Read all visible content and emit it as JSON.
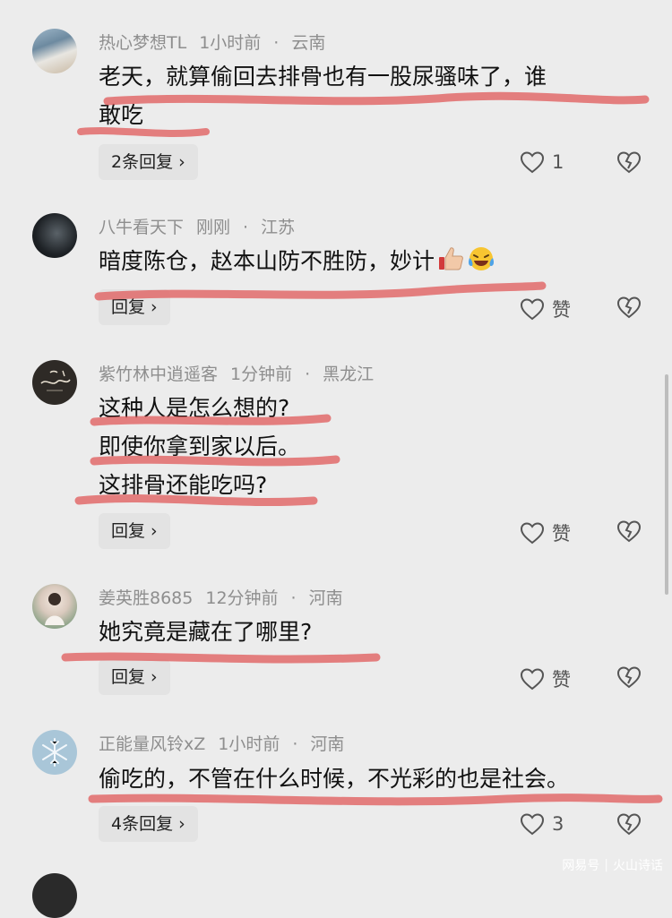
{
  "comments": [
    {
      "username": "热心梦想TL",
      "time": "1小时前",
      "location": "云南",
      "lines": [
        "老天，就算偷回去排骨也有一股尿骚味了，谁",
        "敢吃"
      ],
      "reply_label": "2条回复",
      "like_count": "1"
    },
    {
      "username": "八牛看天下",
      "time": "刚刚",
      "location": "江苏",
      "lines": [
        "暗度陈仓，赵本山防不胜防，妙计"
      ],
      "emojis": [
        "thumbs-up",
        "laughing-crying"
      ],
      "reply_label": "回复",
      "like_count": "赞"
    },
    {
      "username": "紫竹林中逍遥客",
      "time": "1分钟前",
      "location": "黑龙江",
      "lines": [
        "这种人是怎么想的?",
        "即使你拿到家以后。",
        "这排骨还能吃吗?"
      ],
      "reply_label": "回复",
      "like_count": "赞"
    },
    {
      "username": "姜英胜8685",
      "time": "12分钟前",
      "location": "河南",
      "lines": [
        "她究竟是藏在了哪里?"
      ],
      "reply_label": "回复",
      "like_count": "赞"
    },
    {
      "username": "正能量风铃xZ",
      "time": "1小时前",
      "location": "河南",
      "lines": [
        "偷吃的，不管在什么时候，不光彩的也是社会。"
      ],
      "reply_label": "4条回复",
      "like_count": "3"
    }
  ],
  "watermark": {
    "left": "网易号",
    "right": "火山诗话"
  },
  "colors": {
    "background": "#ececec",
    "meta_text": "#8e8e8e",
    "highlight_stroke": "#e05a5a"
  }
}
